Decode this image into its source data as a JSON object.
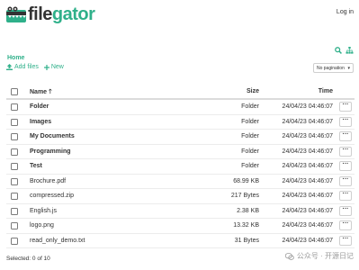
{
  "app": {
    "brand_prefix": "file",
    "brand_suffix": "gator"
  },
  "header": {
    "login_label": "Log in"
  },
  "breadcrumb": {
    "home_label": "Home"
  },
  "toolbar": {
    "add_files_label": "Add files",
    "new_label": "New"
  },
  "pagination": {
    "selected": "No pagination"
  },
  "table": {
    "columns": {
      "name": "Name",
      "size": "Size",
      "time": "Time"
    },
    "rows": [
      {
        "name": "Folder",
        "size": "Folder",
        "time": "24/04/23 04:46:07",
        "type": "folder"
      },
      {
        "name": "Images",
        "size": "Folder",
        "time": "24/04/23 04:46:07",
        "type": "folder"
      },
      {
        "name": "My Documents",
        "size": "Folder",
        "time": "24/04/23 04:46:07",
        "type": "folder"
      },
      {
        "name": "Programming",
        "size": "Folder",
        "time": "24/04/23 04:46:07",
        "type": "folder"
      },
      {
        "name": "Test",
        "size": "Folder",
        "time": "24/04/23 04:46:07",
        "type": "folder"
      },
      {
        "name": "Brochure.pdf",
        "size": "68.99 KB",
        "time": "24/04/23 04:46:07",
        "type": "file"
      },
      {
        "name": "compressed.zip",
        "size": "217 Bytes",
        "time": "24/04/23 04:46:07",
        "type": "file"
      },
      {
        "name": "English.js",
        "size": "2.38 KB",
        "time": "24/04/23 04:46:07",
        "type": "file"
      },
      {
        "name": "logo.png",
        "size": "13.32 KB",
        "time": "24/04/23 04:46:07",
        "type": "file"
      },
      {
        "name": "read_only_demo.txt",
        "size": "31 Bytes",
        "time": "24/04/23 04:46:07",
        "type": "file"
      }
    ],
    "row_menu_label": "···"
  },
  "footer": {
    "selected_text": "Selected: 0 of 10"
  },
  "watermark": {
    "text": "公众号 · 开源日记"
  },
  "colors": {
    "accent": "#2fb08a",
    "text": "#333333"
  }
}
